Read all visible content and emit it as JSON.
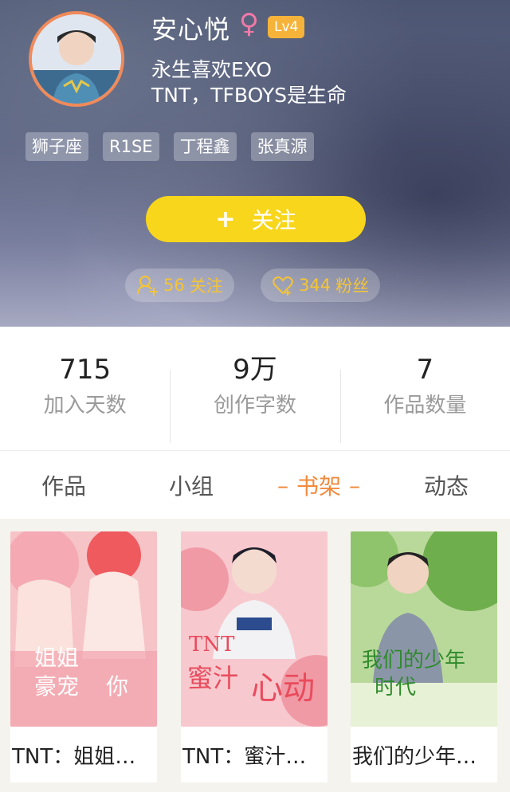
{
  "profile": {
    "name": "安心悦",
    "gender_symbol": "♀",
    "level": "Lv4",
    "bio_line1": "永生喜欢EXO",
    "bio_line2": "TNT，TFBOYS是生命",
    "tags": [
      "狮子座",
      "R1SE",
      "丁程鑫",
      "张真源"
    ]
  },
  "follow_button": {
    "plus": "+",
    "label": "关注"
  },
  "following": {
    "count": "56",
    "label": "关注"
  },
  "fans": {
    "count": "344",
    "label": "粉丝"
  },
  "stats": [
    {
      "value": "715",
      "label": "加入天数"
    },
    {
      "value": "9万",
      "label": "创作字数"
    },
    {
      "value": "7",
      "label": "作品数量"
    }
  ],
  "tabs": [
    {
      "label": "作品"
    },
    {
      "label": "小组"
    },
    {
      "label": "书架",
      "dash": "–"
    },
    {
      "label": "动态"
    }
  ],
  "books": [
    {
      "title": "TNT：姐姐…",
      "cover_text_1": "姐姐",
      "cover_text_2": "豪宠",
      "cover_text_3": "你"
    },
    {
      "title": "TNT：蜜汁…",
      "cover_text_1": "TNT",
      "cover_text_2": "蜜汁",
      "cover_text_3": "心动"
    },
    {
      "title": "我们的少年…",
      "cover_text_1": "我们的少年",
      "cover_text_2": "时代"
    }
  ],
  "colors": {
    "accent": "#f08a3c",
    "follow_button": "#f8d61c",
    "level_badge": "#f6b33a",
    "pill_text": "#f5c435"
  }
}
